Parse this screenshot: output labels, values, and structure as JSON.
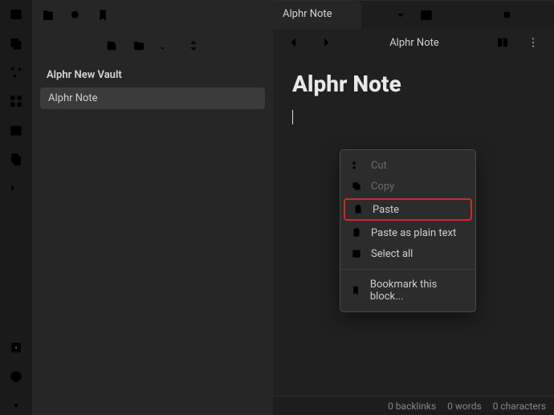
{
  "sidebar": {
    "vault_title": "Alphr New Vault",
    "files": [
      {
        "name": "Alphr Note",
        "selected": true
      }
    ]
  },
  "tabs": {
    "active": {
      "label": "Alphr Note"
    }
  },
  "subbar": {
    "title": "Alphr Note"
  },
  "document": {
    "title": "Alphr Note"
  },
  "context_menu": {
    "cut": "Cut",
    "copy": "Copy",
    "paste": "Paste",
    "paste_plain": "Paste as plain text",
    "select_all": "Select all",
    "bookmark": "Bookmark this block...",
    "highlighted": "paste"
  },
  "status": {
    "backlinks": "0 backlinks",
    "words": "0 words",
    "chars": "0 characters"
  }
}
